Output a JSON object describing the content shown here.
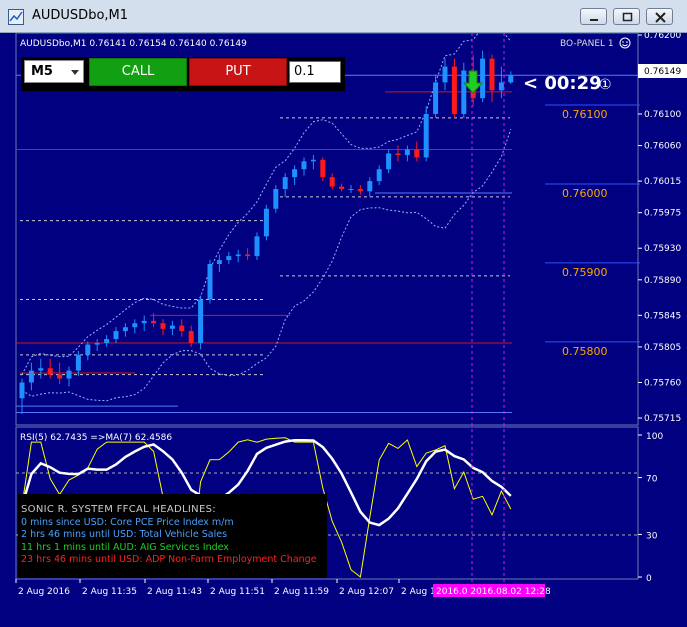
{
  "window": {
    "title": "AUDUSDbo,M1",
    "buttons": [
      "minimize",
      "restore",
      "close"
    ]
  },
  "chart_header": {
    "symbol_info": "AUDUSDbo,M1  0.76141 0.76154 0.76140 0.76149",
    "top_right_label": "BO-PANEL 1"
  },
  "trade_panel": {
    "timeframe": "M5",
    "call_label": "CALL",
    "put_label": "PUT",
    "amount": "0.1"
  },
  "countdown": {
    "text": "< 00:29",
    "badge": "①"
  },
  "current_price": "0.76149",
  "price_axis_labels": [
    {
      "text": "0.76200",
      "y": 0.762
    },
    {
      "text": "0.76149",
      "y": 0.76149
    },
    {
      "text": "0.76100",
      "y": 0.761
    },
    {
      "text": "0.76060",
      "y": 0.7606
    },
    {
      "text": "0.76015",
      "y": 0.76015
    },
    {
      "text": "0.75975",
      "y": 0.75975
    },
    {
      "text": "0.75930",
      "y": 0.7593
    },
    {
      "text": "0.75890",
      "y": 0.7589
    },
    {
      "text": "0.75845",
      "y": 0.75845
    },
    {
      "text": "0.75805",
      "y": 0.75805
    },
    {
      "text": "0.75760",
      "y": 0.7576
    },
    {
      "text": "0.75715",
      "y": 0.75715
    }
  ],
  "level_labels": [
    {
      "text": "0.76100",
      "value": 0.761
    },
    {
      "text": "0.76000",
      "value": 0.76
    },
    {
      "text": "0.75900",
      "value": 0.759
    },
    {
      "text": "0.75800",
      "value": 0.758
    }
  ],
  "rsi": {
    "label": "RSI(5) 62.7435  =>MA(7) 62.4586",
    "axis_labels": [
      {
        "text": "100",
        "value": 100
      },
      {
        "text": "70",
        "value": 70
      },
      {
        "text": "30",
        "value": 30
      },
      {
        "text": "0",
        "value": 0
      }
    ]
  },
  "news": {
    "header": "SONIC R. SYSTEM  FFCAL HEADLINES:",
    "lines": [
      {
        "text": "0 mins since USD: Core PCE Price Index m/m",
        "color": "#4aa0ff"
      },
      {
        "text": "2 hrs 46 mins until USD: Total Vehicle Sales",
        "color": "#4aa0ff"
      },
      {
        "text": "11 hrs 1 mins until AUD: AIG Services Index",
        "color": "#22cc22"
      },
      {
        "text": "23 hrs 46 mins until USD: ADP Non-Farm Employment Change",
        "color": "#ff2020"
      }
    ]
  },
  "time_axis_labels": [
    "2 Aug 2016",
    "2 Aug 11:35",
    "2 Aug 11:43",
    "2 Aug 11:51",
    "2 Aug 11:59",
    "2 Aug 12:07",
    "2 Aug 1"
  ],
  "time_highlight": "2016.0 2016.08.02 12:28",
  "colors": {
    "background": "#000080",
    "bull_candle": "#1e90ff",
    "bear_candle": "#ff1a1a",
    "level_label": "#ffa500",
    "rsi_line": "#ffff00",
    "ma_line": "#ffffff",
    "highlight": "#ff00ff"
  },
  "chart_data": {
    "type": "candlestick",
    "candles": [
      [
        0.7574,
        0.75765,
        0.7572,
        0.7576
      ],
      [
        0.7576,
        0.75785,
        0.7575,
        0.75775
      ],
      [
        0.75775,
        0.7579,
        0.75765,
        0.75778
      ],
      [
        0.75778,
        0.7579,
        0.75765,
        0.7577
      ],
      [
        0.7577,
        0.75785,
        0.75758,
        0.75765
      ],
      [
        0.75765,
        0.7578,
        0.75755,
        0.75775
      ],
      [
        0.75775,
        0.758,
        0.75768,
        0.75795
      ],
      [
        0.75795,
        0.75812,
        0.75788,
        0.75808
      ],
      [
        0.75808,
        0.75815,
        0.758,
        0.7581
      ],
      [
        0.7581,
        0.7582,
        0.75805,
        0.75815
      ],
      [
        0.75815,
        0.7583,
        0.7581,
        0.75825
      ],
      [
        0.75825,
        0.75835,
        0.75818,
        0.7583
      ],
      [
        0.7583,
        0.7584,
        0.75822,
        0.75835
      ],
      [
        0.75835,
        0.75845,
        0.75825,
        0.75838
      ],
      [
        0.75838,
        0.75848,
        0.7583,
        0.75835
      ],
      [
        0.75835,
        0.7584,
        0.7582,
        0.75828
      ],
      [
        0.75828,
        0.75838,
        0.7582,
        0.75832
      ],
      [
        0.75832,
        0.7584,
        0.75818,
        0.75825
      ],
      [
        0.75825,
        0.75832,
        0.75805,
        0.7581
      ],
      [
        0.7581,
        0.7587,
        0.75802,
        0.75865
      ],
      [
        0.75865,
        0.75915,
        0.7586,
        0.7591
      ],
      [
        0.7591,
        0.75922,
        0.759,
        0.75915
      ],
      [
        0.75915,
        0.75925,
        0.7591,
        0.7592
      ],
      [
        0.7592,
        0.75928,
        0.75912,
        0.75922
      ],
      [
        0.75922,
        0.7593,
        0.75915,
        0.7592
      ],
      [
        0.7592,
        0.7595,
        0.75915,
        0.75945
      ],
      [
        0.75945,
        0.75985,
        0.7594,
        0.7598
      ],
      [
        0.7598,
        0.7601,
        0.75975,
        0.76005
      ],
      [
        0.76005,
        0.76025,
        0.75995,
        0.7602
      ],
      [
        0.7602,
        0.76035,
        0.7601,
        0.7603
      ],
      [
        0.7603,
        0.76045,
        0.76022,
        0.7604
      ],
      [
        0.7604,
        0.76048,
        0.7603,
        0.76042
      ],
      [
        0.76042,
        0.76045,
        0.76015,
        0.7602
      ],
      [
        0.7602,
        0.76025,
        0.76005,
        0.76008
      ],
      [
        0.76008,
        0.76012,
        0.76002,
        0.76005
      ],
      [
        0.76005,
        0.7601,
        0.76,
        0.76005
      ],
      [
        0.76005,
        0.7601,
        0.75998,
        0.76002
      ],
      [
        0.76002,
        0.7602,
        0.75995,
        0.76015
      ],
      [
        0.76015,
        0.76035,
        0.7601,
        0.7603
      ],
      [
        0.7603,
        0.76055,
        0.76025,
        0.7605
      ],
      [
        0.7605,
        0.7606,
        0.7604,
        0.76048
      ],
      [
        0.76048,
        0.7606,
        0.7604,
        0.76055
      ],
      [
        0.76055,
        0.76065,
        0.7604,
        0.76045
      ],
      [
        0.76045,
        0.7611,
        0.7604,
        0.761
      ],
      [
        0.761,
        0.7615,
        0.76095,
        0.7614
      ],
      [
        0.7614,
        0.7617,
        0.7613,
        0.7616
      ],
      [
        0.7616,
        0.7617,
        0.76095,
        0.761
      ],
      [
        0.761,
        0.76165,
        0.76095,
        0.76155
      ],
      [
        0.76155,
        0.76175,
        0.7611,
        0.7612
      ],
      [
        0.7612,
        0.7618,
        0.76115,
        0.7617
      ],
      [
        0.7617,
        0.76175,
        0.76115,
        0.7613
      ],
      [
        0.7613,
        0.7616,
        0.7612,
        0.7614
      ],
      [
        0.7614,
        0.76154,
        0.76138,
        0.76149
      ]
    ]
  }
}
